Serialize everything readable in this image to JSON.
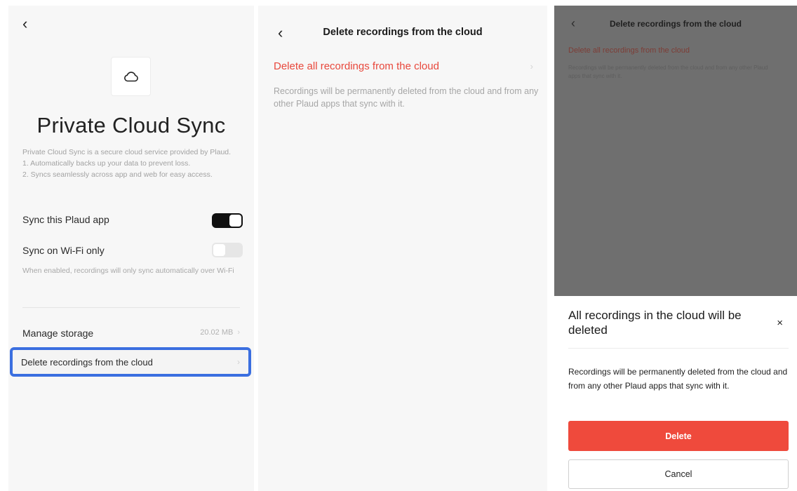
{
  "screen1": {
    "back_glyph": "‹",
    "title": "Private Cloud Sync",
    "description_lines": [
      "Private Cloud Sync is a secure cloud service provided by Plaud.",
      "1. Automatically backs up your data to prevent loss.",
      "2. Syncs seamlessly across app and web for easy access."
    ],
    "sync_app_label": "Sync this Plaud app",
    "sync_app_enabled": true,
    "sync_wifi_label": "Sync on Wi-Fi only",
    "sync_wifi_enabled": false,
    "sync_wifi_note": "When enabled, recordings will only sync automatically over Wi-Fi",
    "manage_storage_label": "Manage storage",
    "manage_storage_value": "20.02 MB",
    "chevron": "›",
    "delete_recordings_label": "Delete recordings from the cloud",
    "highlight_color": "#3b6fe0"
  },
  "screen2": {
    "back_glyph": "‹",
    "header": "Delete recordings from the cloud",
    "delete_all_label": "Delete all recordings from the cloud",
    "chevron": "›",
    "description": "Recordings will be permanently deleted from the cloud and from any other Plaud apps that sync with it.",
    "accent_color": "#e8483c"
  },
  "screen3": {
    "back_glyph": "‹",
    "header": "Delete recordings from the cloud",
    "delete_all_label": "Delete all recordings from the cloud",
    "description": "Recordings will be permanently deleted from the cloud and from any other Plaud apps that sync with it.",
    "dialog": {
      "title": "All recordings in the cloud will be deleted",
      "close_glyph": "×",
      "message": "Recordings will be permanently deleted from the cloud and from any other Plaud apps that sync with it.",
      "confirm_label": "Delete",
      "cancel_label": "Cancel",
      "confirm_color": "#ef4a3c"
    }
  }
}
